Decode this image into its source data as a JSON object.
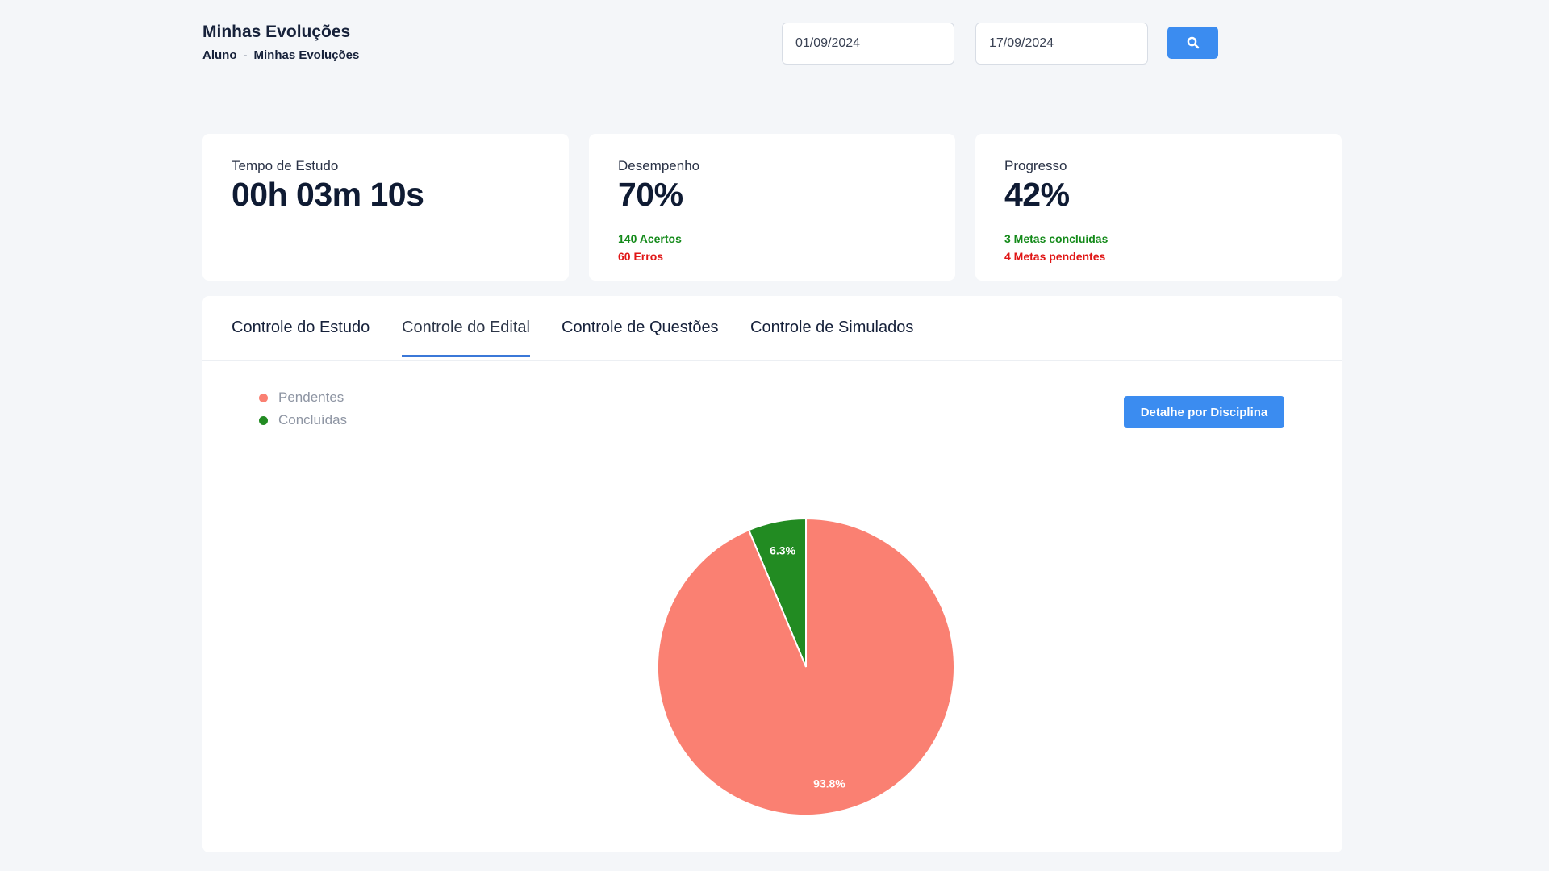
{
  "header": {
    "title": "Minhas Evoluções",
    "breadcrumb": [
      "Aluno",
      "Minhas Evoluções"
    ],
    "breadcrumb_separator": "-",
    "date_start": "01/09/2024",
    "date_end": "17/09/2024",
    "search_icon": "search-icon"
  },
  "cards": [
    {
      "label": "Tempo de Estudo",
      "value": "00h 03m 10s"
    },
    {
      "label": "Desempenho",
      "value": "70%",
      "sub_positive": "140 Acertos",
      "sub_negative": "60 Erros"
    },
    {
      "label": "Progresso",
      "value": "42%",
      "sub_positive": "3 Metas concluídas",
      "sub_negative": "4 Metas pendentes"
    }
  ],
  "tabs": [
    {
      "label": "Controle do Estudo",
      "active": false
    },
    {
      "label": "Controle do Edital",
      "active": true
    },
    {
      "label": "Controle de Questões",
      "active": false
    },
    {
      "label": "Controle de Simulados",
      "active": false
    }
  ],
  "detail_button": "Detalhe por Disciplina",
  "colors": {
    "accent": "#3b8cf0",
    "tab_underline": "#3b78d8",
    "pendentes": "#fa8072",
    "concluidas": "#228b22",
    "positive": "#148a1a",
    "negative": "#e01616"
  },
  "chart_data": {
    "type": "pie",
    "categories": [
      "Pendentes",
      "Concluídas"
    ],
    "values": [
      93.8,
      6.3
    ],
    "data_labels": [
      "93.8%",
      "6.3%"
    ],
    "colors": [
      "#fa8072",
      "#228b22"
    ],
    "legend_position": "top-left"
  }
}
